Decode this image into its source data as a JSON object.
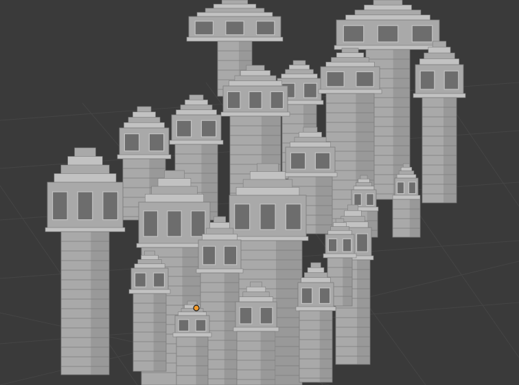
{
  "app": "3D viewport",
  "viewport": {
    "background_color": "#3a3a3a",
    "grid_line_color": "#454545",
    "model_color": "#a9a9a9",
    "model_dark_color": "#7b7b7b",
    "model_light_color": "#c2c2c2",
    "window_color": "#6d6d6d",
    "origin_color": "#f39a2a"
  },
  "scene": {
    "object_name": "voxel-tower-cluster",
    "origin_marker": "object-origin-dot"
  }
}
